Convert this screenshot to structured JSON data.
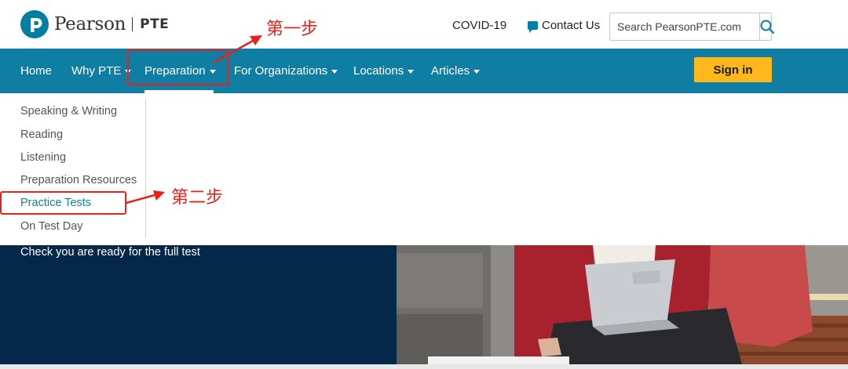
{
  "header": {
    "logo_text": "Pearson",
    "logo_sub": "PTE",
    "covid_label": "COVID-19",
    "contact_label": "Contact Us",
    "search_placeholder": "Search PearsonPTE.com"
  },
  "nav": {
    "items": [
      {
        "label": "Home",
        "has_caret": false
      },
      {
        "label": "Why PTE",
        "has_caret": true
      },
      {
        "label": "Preparation",
        "has_caret": true,
        "active": true
      },
      {
        "label": "For Organizations",
        "has_caret": true
      },
      {
        "label": "Locations",
        "has_caret": true
      },
      {
        "label": "Articles",
        "has_caret": true
      }
    ],
    "signin_label": "Sign in"
  },
  "dropdown": {
    "items": [
      {
        "label": "Speaking & Writing"
      },
      {
        "label": "Reading"
      },
      {
        "label": "Listening"
      },
      {
        "label": "Preparation Resources"
      },
      {
        "label": "Practice Tests",
        "highlighted": true
      },
      {
        "label": "On Test Day"
      }
    ]
  },
  "hero": {
    "text": "Check you are ready for the full test"
  },
  "annotations": {
    "step1": "第一步",
    "step2": "第二步"
  },
  "colors": {
    "nav_bg": "#0f7ea2",
    "signin_bg": "#ffb81c",
    "hero_bg": "#05284a",
    "annotation": "#e8221b",
    "brand": "#007fa3"
  }
}
